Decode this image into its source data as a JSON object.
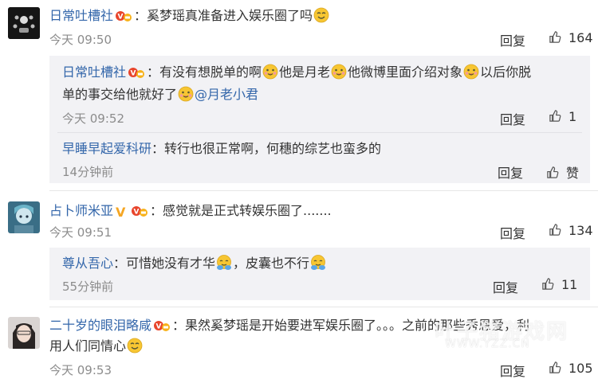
{
  "comments": [
    {
      "username": "日常吐槽社",
      "text": "：奚梦瑶真准备进入娱乐圈了吗",
      "time": "今天 09:50",
      "reply_label": "回复",
      "likes": "164",
      "replies": [
        {
          "username": "日常吐槽社",
          "text_line1_a": "：有没有想脱单的啊",
          "text_line1_b": "他是月老",
          "text_line1_c": "他微博里面介绍对象",
          "text_line1_d": "以后你脱",
          "text_line2_a": "单的事交给他就好了",
          "mention": "@月老小君",
          "time": "今天 09:52",
          "reply_label": "回复",
          "likes": "1"
        },
        {
          "username": "早睡早起爱科研",
          "text": "：转行也很正常啊，何穗的综艺也蛮多的",
          "time": "14分钟前",
          "reply_label": "回复",
          "likes": "赞"
        }
      ]
    },
    {
      "username": "占卜师米亚",
      "text": "：感觉就是正式转娱乐圈了.......",
      "time": "今天 09:51",
      "reply_label": "回复",
      "likes": "134",
      "replies": [
        {
          "username": "尊从吾心",
          "text_a": "：可惜她没有才华",
          "text_b": "，皮囊也不行",
          "time": "55分钟前",
          "reply_label": "回复",
          "likes": "11"
        }
      ]
    },
    {
      "username": "二十岁的眼泪略咸",
      "text_line1": "：果然奚梦瑶是开始要进军娱乐圈了。。。之前的那些秀恩爱，利",
      "text_line2": "用人们同情心",
      "time": "今天 09:53",
      "reply_label": "回复",
      "likes": "105"
    }
  ],
  "watermark": {
    "line1": "叶子猪游戏网",
    "line2": "WWW.YZZ.CN"
  },
  "colors": {
    "username": "#3366aa",
    "badge": "#e8452c",
    "emoji": "#f7c632",
    "subcomment_bg": "#f2f2f5"
  }
}
